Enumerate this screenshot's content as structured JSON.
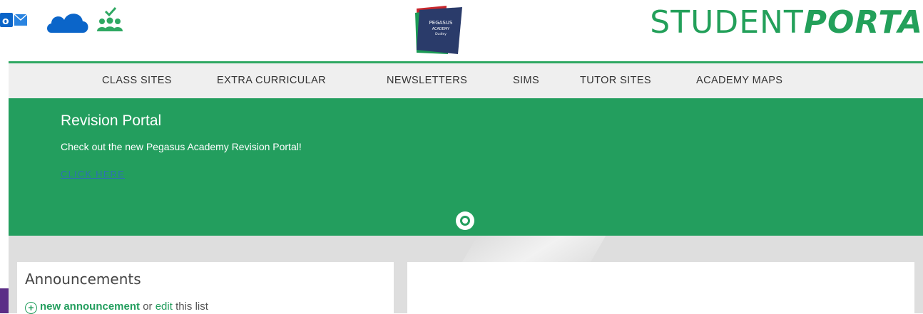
{
  "header": {
    "icons": [
      "outlook-icon",
      "onedrive-icon",
      "people-check-icon"
    ],
    "logo": {
      "line1": "PEGASUS",
      "line2": "ACADEMY",
      "line3": "Dudley"
    },
    "title_regular": "STUDENT",
    "title_bold": "PORTA"
  },
  "nav": {
    "items": [
      "CLASS SITES",
      "EXTRA CURRICULAR",
      "NEWSLETTERS",
      "SIMS",
      "TUTOR SITES",
      "ACADEMY MAPS"
    ]
  },
  "banner": {
    "title": "Revision Portal",
    "text": "Check out the new Pegasus Academy Revision Portal!",
    "link": "CLICK HERE"
  },
  "announcements": {
    "title": "Announcements",
    "new_label": "new announcement",
    "or": " or ",
    "edit_label": "edit",
    "tail": " this list"
  },
  "colors": {
    "brand_green": "#239e5e",
    "nav_bg": "#efefef"
  }
}
